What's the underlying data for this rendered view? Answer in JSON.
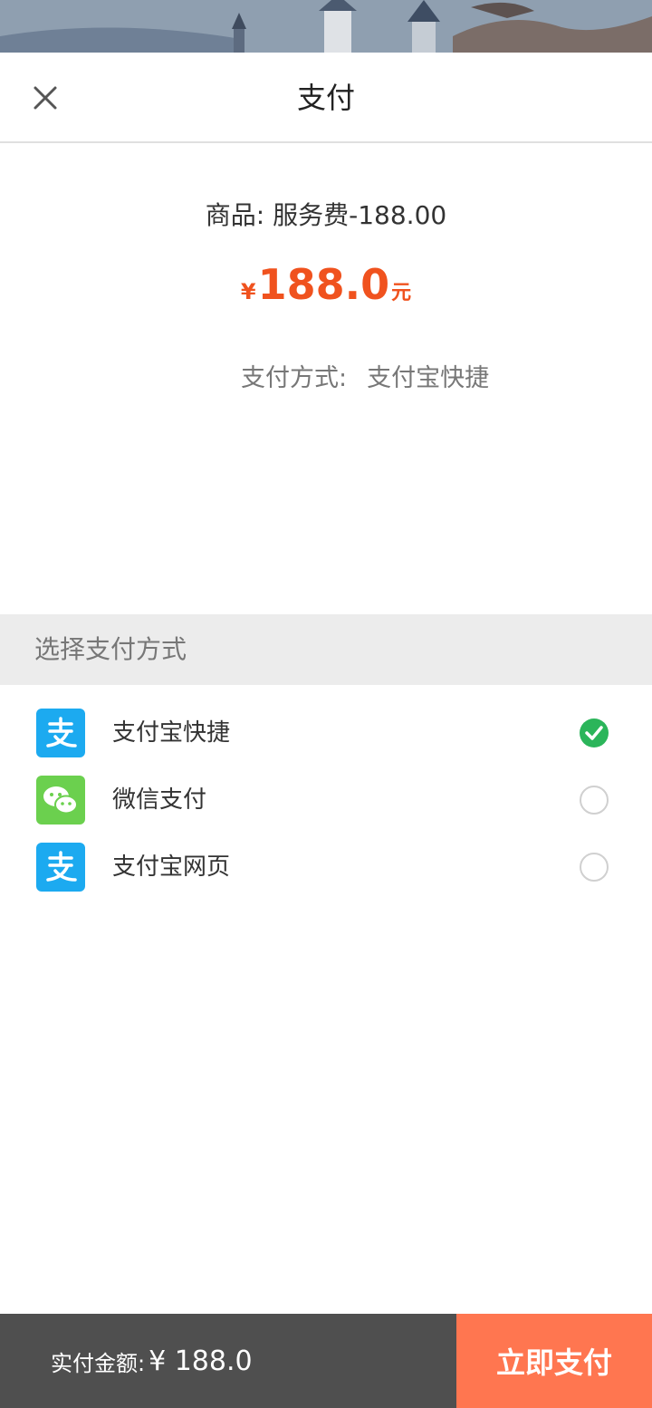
{
  "header": {
    "title": "支付",
    "close_icon": "close-icon"
  },
  "order": {
    "product_text": "商品: 服务费-188.00",
    "price_currency": "¥",
    "price_amount": "188.0",
    "price_unit": "元",
    "method_label": "支付方式:",
    "method_value": "支付宝快捷"
  },
  "methods_section": {
    "title": "选择支付方式",
    "options": [
      {
        "label": "支付宝快捷",
        "icon": "alipay-icon",
        "selected": true
      },
      {
        "label": "微信支付",
        "icon": "wechat-icon",
        "selected": false
      },
      {
        "label": "支付宝网页",
        "icon": "alipay-icon",
        "selected": false
      }
    ]
  },
  "footer": {
    "total_label": "实付金额:",
    "total_amount": "¥ 188.0",
    "pay_button": "立即支付"
  },
  "colors": {
    "accent": "#f0521e",
    "pay_button": "#ff7650",
    "footer_bg": "#4f4f4f",
    "selected": "#2bb55a",
    "alipay": "#1caaf0",
    "wechat": "#6bd04e"
  }
}
